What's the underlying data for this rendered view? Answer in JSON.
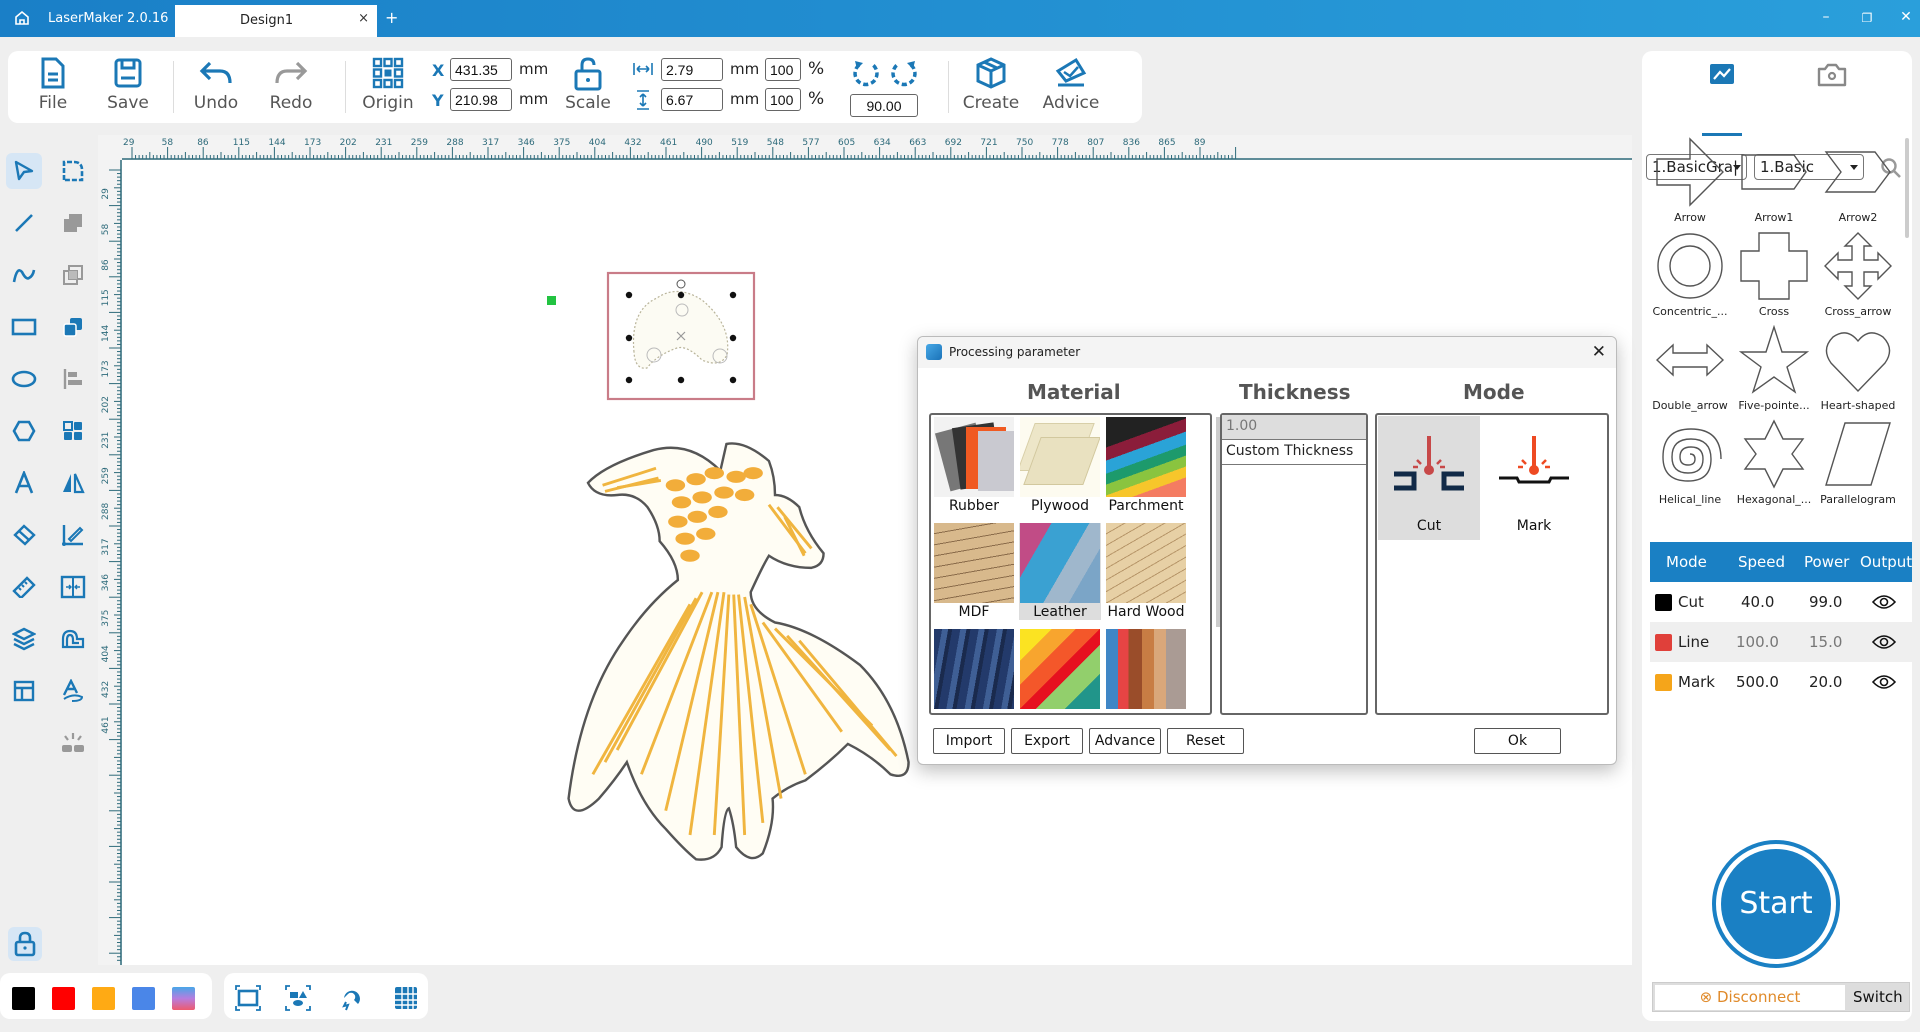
{
  "titlebar": {
    "app_name": "LaserMaker 2.0.16",
    "tab_label": "Design1",
    "tab_close": "×",
    "new_tab": "+",
    "minimize": "–",
    "maximize": "❐",
    "close": "✕"
  },
  "toolbar": {
    "file": "File",
    "save": "Save",
    "undo": "Undo",
    "redo": "Redo",
    "origin": "Origin",
    "scale": "Scale",
    "create": "Create",
    "advice": "Advice",
    "x_label": "X",
    "y_label": "Y",
    "x_value": "431.35",
    "y_value": "210.98",
    "width_value": "2.79",
    "height_value": "6.67",
    "width_pct": "100",
    "height_pct": "100",
    "unit_mm": "mm",
    "unit_pct": "%",
    "rotation": "90.00"
  },
  "rulers": {
    "unit": "mm",
    "top_ticks": [
      "29",
      "58",
      "86",
      "115",
      "144",
      "173",
      "202",
      "231",
      "259",
      "288",
      "317",
      "346",
      "375",
      "404",
      "432",
      "461",
      "490",
      "519",
      "548",
      "577",
      "605",
      "634",
      "663",
      "692",
      "721",
      "750",
      "778",
      "807",
      "836",
      "865",
      "89"
    ],
    "left_ticks": [
      "29",
      "58",
      "86",
      "115",
      "144",
      "173",
      "202",
      "231",
      "259",
      "288",
      "317",
      "346",
      "375",
      "404",
      "432",
      "461"
    ]
  },
  "right_panel": {
    "category_select": "1.BasicGra|",
    "subcategory_select": "1.Basic",
    "shapes": [
      {
        "name": "Arrow",
        "icon": "arrow-shape"
      },
      {
        "name": "Arrow1",
        "icon": "arrow1-shape"
      },
      {
        "name": "Arrow2",
        "icon": "arrow2-shape"
      },
      {
        "name": "Concentric_...",
        "icon": "concentric-circle-shape"
      },
      {
        "name": "Cross",
        "icon": "cross-shape"
      },
      {
        "name": "Cross_arrow",
        "icon": "cross-arrow-shape"
      },
      {
        "name": "Double_arrow",
        "icon": "double-arrow-shape"
      },
      {
        "name": "Five-pointe...",
        "icon": "five-pointed-star-shape"
      },
      {
        "name": "Heart-shaped",
        "icon": "heart-shape"
      },
      {
        "name": "Helical_line",
        "icon": "helical-line-shape"
      },
      {
        "name": "Hexagonal_...",
        "icon": "hexagonal-star-shape"
      },
      {
        "name": "Parallelogram",
        "icon": "parallelogram-shape"
      }
    ],
    "layers_header": {
      "mode": "Mode",
      "speed": "Speed",
      "power": "Power",
      "output": "Output"
    },
    "layers": [
      {
        "color": "#000000",
        "mode": "Cut",
        "speed": "40.0",
        "power": "99.0",
        "visible": true
      },
      {
        "color": "#e0403a",
        "mode": "Line",
        "speed": "100.0",
        "power": "15.0",
        "visible": true
      },
      {
        "color": "#f5a51a",
        "mode": "Mark",
        "speed": "500.0",
        "power": "20.0",
        "visible": true
      }
    ],
    "start": "Start",
    "disconnect": "Disconnect",
    "switch": "Switch"
  },
  "bottom_bar": {
    "colors": [
      "#000000",
      "#ff0000",
      "#ffaa14",
      "#4a86e8",
      "gradient"
    ]
  },
  "dialog": {
    "title": "Processing parameter",
    "material_header": "Material",
    "thickness_header": "Thickness",
    "mode_header": "Mode",
    "materials": [
      {
        "name": "Rubber",
        "selected": false
      },
      {
        "name": "Plywood",
        "selected": false
      },
      {
        "name": "Parchment",
        "selected": false
      },
      {
        "name": "MDF",
        "selected": false
      },
      {
        "name": "Leather",
        "selected": true
      },
      {
        "name": "Hard Wood",
        "selected": false
      },
      {
        "name": "",
        "selected": false
      },
      {
        "name": "",
        "selected": false
      },
      {
        "name": "",
        "selected": false
      }
    ],
    "thickness_options": [
      "1.00",
      "Custom Thickness"
    ],
    "modes": [
      {
        "name": "Cut",
        "selected": true
      },
      {
        "name": "Mark",
        "selected": false
      }
    ],
    "buttons": {
      "import": "Import",
      "export": "Export",
      "advance": "Advance",
      "reset": "Reset",
      "ok": "Ok"
    },
    "close": "✕"
  }
}
